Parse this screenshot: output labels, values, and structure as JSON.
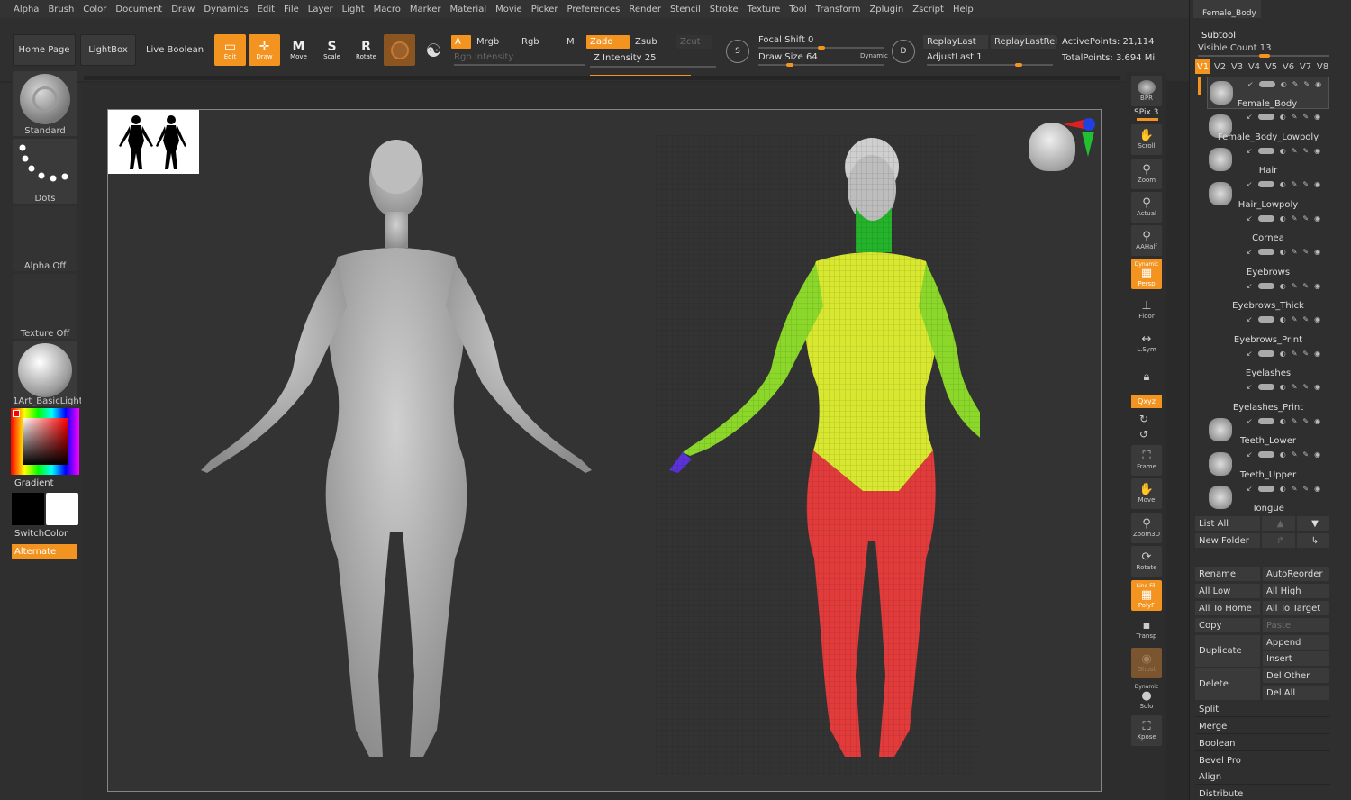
{
  "menu": [
    "Alpha",
    "Brush",
    "Color",
    "Document",
    "Draw",
    "Dynamics",
    "Edit",
    "File",
    "Layer",
    "Light",
    "Macro",
    "Marker",
    "Material",
    "Movie",
    "Picker",
    "Preferences",
    "Render",
    "Stencil",
    "Stroke",
    "Texture",
    "Tool",
    "Transform",
    "Zplugin",
    "Zscript",
    "Help"
  ],
  "top": {
    "home": "Home Page",
    "lightbox": "LightBox",
    "live_boolean": "Live Boolean",
    "edit": "Edit",
    "draw": "Draw",
    "move": "Move",
    "scale": "Scale",
    "rotate": "Rotate",
    "a": "A",
    "mrgb": "Mrgb",
    "rgb": "Rgb",
    "m": "M",
    "zadd": "Zadd",
    "zsub": "Zsub",
    "zcut": "Zcut",
    "rgb_intensity": "Rgb Intensity",
    "z_intensity": "Z Intensity 25",
    "z_intensity_value": 25,
    "focal_shift": "Focal Shift 0",
    "draw_size": "Draw Size 64",
    "dynamic": "Dynamic",
    "replay_last": "ReplayLast",
    "replay_last_rel": "ReplayLastRel",
    "adjust_last": "AdjustLast 1",
    "active_points": "ActivePoints: 21,114",
    "total_points": "TotalPoints: 3.694 Mil"
  },
  "left": {
    "brush": "Standard",
    "stroke": "Dots",
    "alpha": "Alpha Off",
    "texture": "Texture Off",
    "material": "1Art_BasicLight",
    "gradient": "Gradient",
    "switch_color": "SwitchColor",
    "alternate": "Alternate"
  },
  "right_shelf": {
    "bpr": "BPR",
    "spix": "SPix 3",
    "scroll": "Scroll",
    "zoom": "Zoom",
    "actual": "Actual",
    "aahalf": "AAHalf",
    "dynamic": "Dynamic",
    "persp": "Persp",
    "floor": "Floor",
    "lsym": "L.Sym",
    "xyz": "Qxyz",
    "frame": "Frame",
    "move": "Move",
    "zoom3d": "Zoom3D",
    "rotate": "Rotate",
    "linefill": "Line Fill",
    "polyf": "PolyF",
    "transp": "Transp",
    "ghost": "Ghost",
    "solo_dynamic": "Dynamic",
    "solo": "Solo",
    "xpose": "Xpose"
  },
  "subtool": {
    "header_thumb": "Female_Body",
    "title": "Subtool",
    "visible_count": "Visible Count 13",
    "tabs": [
      "V1",
      "V2",
      "V3",
      "V4",
      "V5",
      "V6",
      "V7",
      "V8"
    ],
    "items": [
      "Female_Body",
      "Female_Body_Lowpoly",
      "Hair",
      "Hair_Lowpoly",
      "Cornea",
      "Eyebrows",
      "Eyebrows_Thick",
      "Eyebrows_Print",
      "Eyelashes",
      "Eyelashes_Print",
      "Teeth_Lower",
      "Teeth_Upper",
      "Tongue"
    ],
    "list_all": "List All",
    "new_folder": "New Folder",
    "rename": "Rename",
    "auto_reorder": "AutoReorder",
    "all_low": "All Low",
    "all_high": "All High",
    "all_to_home": "All To Home",
    "all_to_target": "All To Target",
    "copy": "Copy",
    "paste": "Paste",
    "duplicate": "Duplicate",
    "append": "Append",
    "insert": "Insert",
    "delete": "Delete",
    "del_other": "Del Other",
    "del_all": "Del All",
    "split": "Split",
    "merge": "Merge",
    "boolean": "Boolean",
    "bevel_pro": "Bevel Pro",
    "align": "Align",
    "distribute": "Distribute"
  }
}
